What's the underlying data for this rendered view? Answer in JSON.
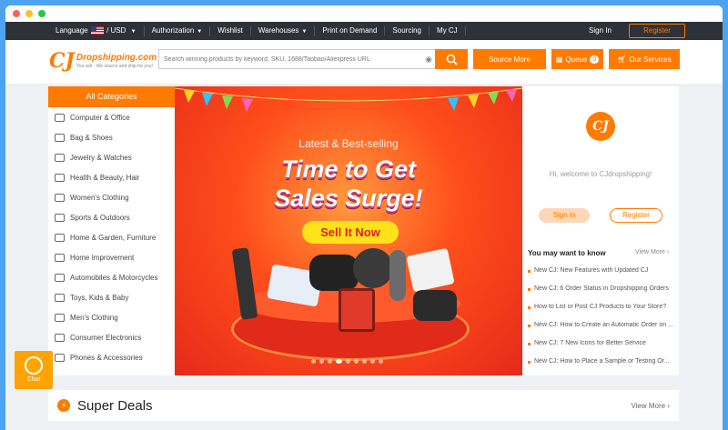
{
  "topbar": {
    "language_label": "Language",
    "currency": "/ USD",
    "authorization": "Authorization",
    "wishlist": "Wishlist",
    "warehouses": "Warehouses",
    "print_on_demand": "Print on Demand",
    "sourcing": "Sourcing",
    "my_cj": "My CJ",
    "sign_in": "Sign In",
    "register": "Register"
  },
  "header": {
    "logo_mark": "CJ",
    "logo_name": "Dropshipping.com",
    "logo_tagline": "You sell - We source and ship for you!",
    "search_placeholder": "Search winning products by keyword, SKU, 1688/Taobao/Aliexpress URL",
    "source_more": "Source More",
    "queue": "Queue",
    "queue_count": "0",
    "our_services": "Our Services"
  },
  "categories": {
    "title": "All Categories",
    "items": [
      "Computer & Office",
      "Bag & Shoes",
      "Jewelry & Watches",
      "Health & Beauty, Hair",
      "Women's Clothing",
      "Sports & Outdoors",
      "Home & Garden, Furniture",
      "Home Improvement",
      "Automobiles & Motorcycles",
      "Toys, Kids & Baby",
      "Men's Clothing",
      "Consumer Electronics",
      "Phones & Accessories"
    ]
  },
  "banner": {
    "subtitle": "Latest & Best-selling",
    "title_line1": "Time to Get",
    "title_line2": "Sales Surge!",
    "cta": "Sell It Now",
    "slide_count": 9,
    "active_slide": 4
  },
  "user_panel": {
    "avatar_mark": "CJ",
    "welcome": "Hi, welcome to CJdropshipping!",
    "sign_in": "Sign In",
    "register": "Register",
    "news_title": "You may want to know",
    "view_more": "View More",
    "news": [
      "New CJ: New Features with Updated CJ",
      "New CJ: 6 Order Status in Dropshipping Orders",
      "How to List or Post CJ Products to Your Store?",
      "New CJ: How to Create an Automatic Order on ...",
      "New CJ: 7 New Icons for Better Service",
      "New CJ: How to Place a Sample or Testing Or..."
    ]
  },
  "super_deals": {
    "title": "Super Deals",
    "view_more": "View More"
  },
  "chat": {
    "label": "Chat"
  },
  "colors": {
    "accent": "#ff7a00",
    "topbar_bg": "#2e3138",
    "page_bg": "#4da3f0"
  }
}
